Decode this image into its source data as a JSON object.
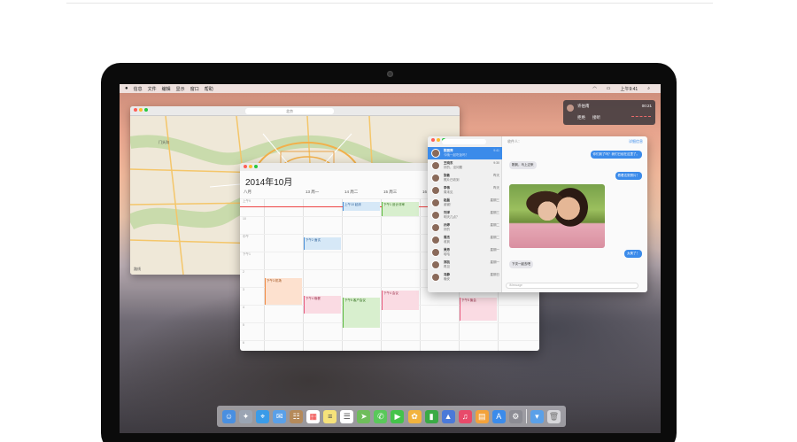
{
  "menubar": {
    "apple": "",
    "items": [
      "信息",
      "文件",
      "编辑",
      "显示",
      "窗口",
      "帮助"
    ],
    "clock": "上午9:41"
  },
  "notification": {
    "name": "许伯南",
    "time": "00:21",
    "decline": "拒绝",
    "accept": "接听"
  },
  "maps": {
    "search_placeholder": "北京",
    "place": "门头沟",
    "footer": "路线"
  },
  "calendar": {
    "month_title": "2014年10月",
    "days": [
      "八月",
      "13 周一",
      "14 周二",
      "15 周三",
      "16 周四",
      "17 周五"
    ],
    "hours": [
      "上午9",
      "10",
      "中午",
      "下午1",
      "2",
      "3",
      "4",
      "5",
      "6"
    ],
    "events": [
      {
        "label": "上午10 起床",
        "color": "blue"
      },
      {
        "label": "下午1 设计评审",
        "color": "green"
      },
      {
        "label": "下午2 面试",
        "color": "blue"
      },
      {
        "label": "下午3 机场",
        "color": "orange"
      },
      {
        "label": "下午4 晚餐",
        "color": "pink"
      },
      {
        "label": "下午5 客户会议",
        "color": "green"
      },
      {
        "label": "下午4 会议",
        "color": "pink"
      },
      {
        "label": "下午5 聚会",
        "color": "pink"
      }
    ]
  },
  "messages": {
    "conversations": [
      {
        "name": "陈丽萍",
        "text": "今晚一起吃饭吗？",
        "time": "9:41"
      },
      {
        "name": "王晓东",
        "text": "好的，没问题",
        "time": "9:30"
      },
      {
        "name": "张敏",
        "text": "照片已收到",
        "time": "昨天"
      },
      {
        "name": "李伟",
        "text": "周末见",
        "time": "昨天"
      },
      {
        "name": "赵磊",
        "text": "谢谢！",
        "time": "星期三"
      },
      {
        "name": "刘洋",
        "text": "明天几点？",
        "time": "星期三"
      },
      {
        "name": "孙婷",
        "text": "好的",
        "time": "星期二"
      },
      {
        "name": "周杰",
        "text": "收到",
        "time": "星期二"
      },
      {
        "name": "吴芳",
        "text": "哈哈",
        "time": "星期一"
      },
      {
        "name": "郑凯",
        "text": "再见",
        "time": "星期一"
      },
      {
        "name": "冯静",
        "text": "晚安",
        "time": "星期日"
      }
    ],
    "header": "收件人：",
    "details": "详细信息",
    "bubbles": [
      {
        "text": "你们到了吗？我们已经在这里了。",
        "from": "me"
      },
      {
        "text": "刚到，马上过来",
        "from": "them"
      },
      {
        "text": "看看这张照片！",
        "from": "me"
      },
      {
        "text": "太美了！",
        "from": "them"
      },
      {
        "text": "下次一起去吧",
        "from": "me"
      }
    ],
    "input_placeholder": "iMessage"
  },
  "dock": {
    "icons": [
      "finder-icon",
      "launchpad-icon",
      "safari-icon",
      "mail-icon",
      "contacts-icon",
      "calendar-icon",
      "notes-icon",
      "reminders-icon",
      "maps-icon",
      "messages-icon",
      "facetime-icon",
      "photos-icon",
      "numbers-icon",
      "keynote-icon",
      "itunes-icon",
      "ibooks-icon",
      "appstore-icon",
      "preferences-icon",
      "downloads-icon",
      "trash-icon"
    ],
    "colors": [
      "#4a8fe0",
      "#9aa4b3",
      "#3a9be8",
      "#5aa0e8",
      "#b58a5a",
      "#ffffff",
      "#f6e27a",
      "#ffffff",
      "#6fbd5b",
      "#5ac85a",
      "#44c34a",
      "#f2b33d",
      "#3aaa45",
      "#4b79d8",
      "#e84a6a",
      "#f3a23b",
      "#3b8bea",
      "#8c8c94",
      "#5aa0e8",
      "#d6d6da"
    ]
  }
}
